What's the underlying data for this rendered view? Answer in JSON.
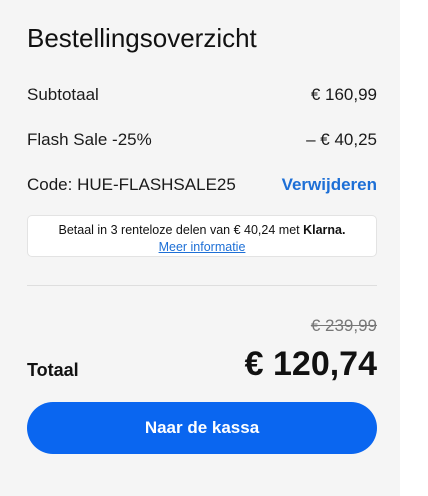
{
  "summary": {
    "title": "Bestellingsoverzicht",
    "subtotal_label": "Subtotaal",
    "subtotal_value": "€ 160,99",
    "discount_label": "Flash Sale -25%",
    "discount_value": "– € 40,25",
    "code_label": "Code: HUE-FLASHSALE25",
    "remove_label": "Verwijderen"
  },
  "klarna": {
    "text": "Betaal in 3 renteloze delen van € 40,24 met",
    "logo": "Klarna.",
    "link": "Meer informatie"
  },
  "total": {
    "old_value": "€ 239,99",
    "label": "Totaal",
    "value": "€ 120,74"
  },
  "checkout": {
    "button_label": "Naar de kassa"
  },
  "colors": {
    "accent": "#0a66f0",
    "link": "#1d6fd6"
  }
}
